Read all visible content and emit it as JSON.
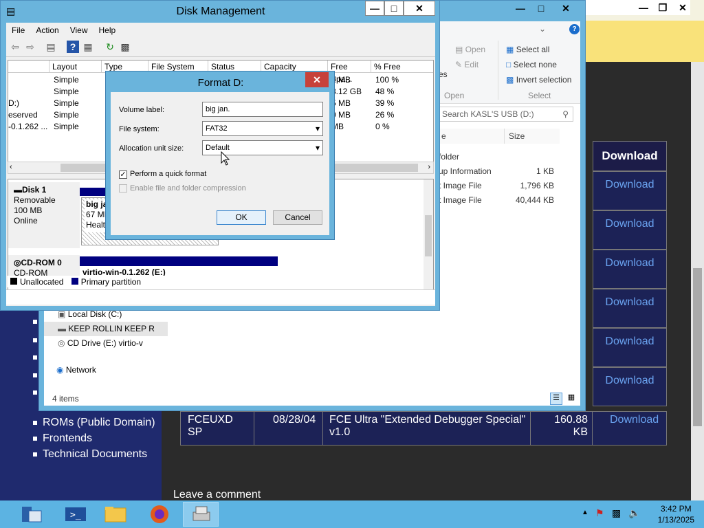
{
  "web": {
    "table_header": "Download",
    "download_links": [
      "Download",
      "Download",
      "Download",
      "Download",
      "Download",
      "Download"
    ],
    "last_row": {
      "name": "FCEUXD SP",
      "date": "08/28/04",
      "desc": "FCE Ultra \"Extended Debugger Special\" v1.0",
      "size": "160.88 KB",
      "link": "Download"
    },
    "sidebar_links": [
      "ROMs (Public Domain)",
      "Frontends",
      "Technical Documents"
    ],
    "leave_comment": "Leave a comment"
  },
  "explorer": {
    "ribbon": {
      "open": "Open",
      "edit": "Edit",
      "open_group": "Open",
      "select_all": "Select all",
      "select_none": "Select none",
      "invert_selection": "Invert selection",
      "select_group": "Select",
      "partial_es": "es"
    },
    "search_placeholder": "Search KASL'S USB (D:)",
    "columns": {
      "name": "e",
      "size": "Size"
    },
    "files": [
      {
        "name": "folder",
        "size": ""
      },
      {
        "name": "up Information",
        "size": "1 KB"
      },
      {
        "name": "t Image File",
        "size": "1,796 KB"
      },
      {
        "name": "t Image File",
        "size": "40,444 KB"
      }
    ],
    "nav": [
      {
        "label": "Local Disk (C:)",
        "icon": "hard-drive-icon"
      },
      {
        "label": "KEEP ROLLIN KEEP R",
        "icon": "usb-drive-icon"
      },
      {
        "label": "CD Drive (E:) virtio-v",
        "icon": "cd-drive-icon"
      }
    ],
    "network": "Network",
    "status": "4 items"
  },
  "diskmgmt": {
    "title": "Disk Management",
    "menu": [
      "File",
      "Action",
      "View",
      "Help"
    ],
    "columns": [
      "Layout",
      "Type",
      "File System",
      "Status",
      "Capacity",
      "Free Spa...",
      "% Free"
    ],
    "rows": [
      {
        "vol": "",
        "layout": "Simple",
        "free": "2 MB",
        "pct": "100 %"
      },
      {
        "vol": "",
        "layout": "Simple",
        "free": "8.12 GB",
        "pct": "48 %"
      },
      {
        "vol": "D:)",
        "layout": "Simple",
        "free": "5 MB",
        "pct": "39 %"
      },
      {
        "vol": "eserved",
        "layout": "Simple",
        "free": "0 MB",
        "pct": "26 %"
      },
      {
        "vol": "-0.1.262 ...",
        "layout": "Simple",
        "free": "MB",
        "pct": "0 %"
      }
    ],
    "disk1": {
      "name": "Disk 1",
      "type": "Removable",
      "size": "100 MB",
      "status": "Online",
      "part_name": "big jar",
      "part_size": "67 MB",
      "part_status": "Health"
    },
    "cdrom": {
      "name": "CD-ROM 0",
      "type": "CD-ROM",
      "part_name": "virtio-win-0.1.262  (E:)"
    },
    "legend": {
      "unallocated": "Unallocated",
      "primary": "Primary partition"
    }
  },
  "format": {
    "title": "Format D:",
    "volume_label_label": "Volume label:",
    "volume_label_value": "big jan.",
    "fs_label": "File system:",
    "fs_value": "FAT32",
    "alloc_label": "Allocation unit size:",
    "alloc_value": "Default",
    "quick_format": "Perform a quick format",
    "compression": "Enable file and folder compression",
    "ok": "OK",
    "cancel": "Cancel"
  },
  "taskbar": {
    "time": "3:42 PM",
    "date": "1/13/2025"
  },
  "colors": {
    "accent": "#6ab4dc",
    "taskbar": "#5cb3e2",
    "primary_partition": "#000080",
    "close_red": "#c7413a",
    "web_link": "#6aa3f0"
  }
}
